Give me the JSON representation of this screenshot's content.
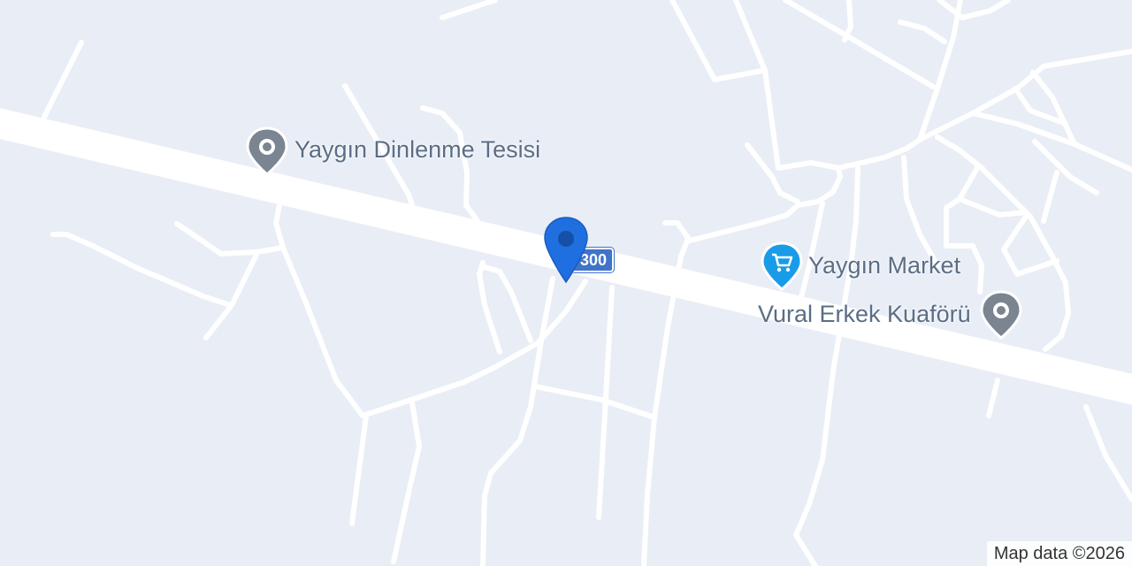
{
  "map": {
    "road_shield": "300",
    "attribution": "Map data ©2026",
    "pois": [
      {
        "name": "Yaygın Dinlenme Tesisi",
        "icon": "pin-icon",
        "color": "#7a8591"
      },
      {
        "name": "Yaygın Market",
        "icon": "shopping-cart-icon",
        "color": "#1a9be8"
      },
      {
        "name": "Vural Erkek Kuaförü",
        "icon": "pin-icon",
        "color": "#7a8591"
      }
    ],
    "location_marker": {
      "icon": "location-marker-icon",
      "color": "#1f6fe0"
    },
    "colors": {
      "background": "#e9edf5",
      "road": "#ffffff",
      "label": "#5a6e86",
      "shield": "#3f74c9"
    }
  }
}
